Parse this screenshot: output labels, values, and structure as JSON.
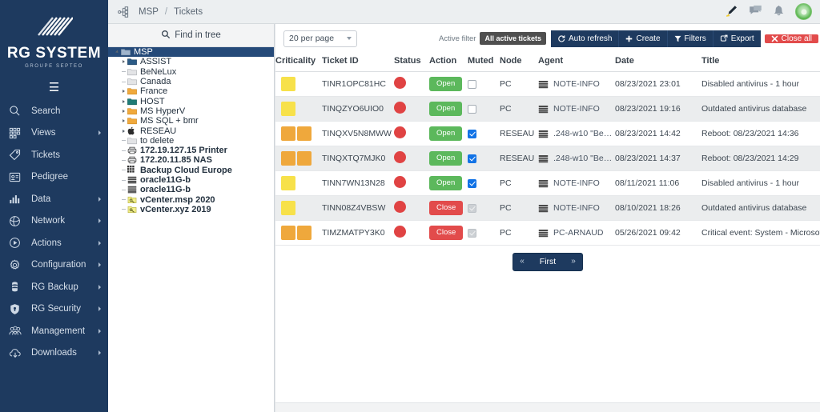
{
  "brand": {
    "name": "RG SYSTEM",
    "tagline": "GROUPE SEPTEO",
    "logo_icon": "rg-diagonal-stripes-logo",
    "menu_icon": "hamburger-menu-icon",
    "accent_navy": "#1e3a5f"
  },
  "sidebar": {
    "items": [
      {
        "label": "Search",
        "icon": "search-icon",
        "caret": false
      },
      {
        "label": "Views",
        "icon": "grid-views-icon",
        "caret": true
      },
      {
        "label": "Tickets",
        "icon": "tag-tickets-icon",
        "caret": false
      },
      {
        "label": "Pedigree",
        "icon": "id-card-icon",
        "caret": false
      },
      {
        "label": "Data",
        "icon": "bar-chart-icon",
        "caret": true
      },
      {
        "label": "Network",
        "icon": "network-globe-icon",
        "caret": true
      },
      {
        "label": "Actions",
        "icon": "play-circle-icon",
        "caret": true
      },
      {
        "label": "Configuration",
        "icon": "gear-icon",
        "caret": true
      },
      {
        "label": "RG Backup",
        "icon": "database-stack-icon",
        "caret": true
      },
      {
        "label": "RG Security",
        "icon": "shield-lock-icon",
        "caret": true
      },
      {
        "label": "Management",
        "icon": "users-group-icon",
        "caret": true
      },
      {
        "label": "Downloads",
        "icon": "download-cloud-icon",
        "caret": true
      }
    ]
  },
  "topbar": {
    "org_icon": "org-tree-icon",
    "breadcrumb": [
      "MSP",
      "Tickets"
    ],
    "separator": "/",
    "icons": [
      {
        "name": "pen-highlighter-icon"
      },
      {
        "name": "chat-bubble-icon"
      },
      {
        "name": "bell-notification-icon"
      },
      {
        "name": "user-avatar-icon"
      }
    ]
  },
  "tree": {
    "search_label": "Find in tree",
    "search_icon": "search-icon",
    "nodes": [
      {
        "label": "MSP",
        "icon": "folder-blue",
        "expander": "expanded",
        "selected": true,
        "bold": false,
        "indent": 0
      },
      {
        "label": "ASSIST",
        "icon": "folder-navy",
        "expander": "collapsed",
        "selected": false,
        "bold": false,
        "indent": 1
      },
      {
        "label": "BeNeLux",
        "icon": "folder-grey",
        "expander": "leaf",
        "selected": false,
        "bold": false,
        "indent": 1
      },
      {
        "label": "Canada",
        "icon": "folder-grey",
        "expander": "leaf",
        "selected": false,
        "bold": false,
        "indent": 1
      },
      {
        "label": "France",
        "icon": "folder-orange",
        "expander": "collapsed",
        "selected": false,
        "bold": false,
        "indent": 1
      },
      {
        "label": "HOST",
        "icon": "folder-teal",
        "expander": "collapsed",
        "selected": false,
        "bold": false,
        "indent": 1
      },
      {
        "label": "MS HyperV",
        "icon": "folder-orange",
        "expander": "collapsed",
        "selected": false,
        "bold": false,
        "indent": 1
      },
      {
        "label": "MS SQL + bmr",
        "icon": "folder-orange",
        "expander": "collapsed",
        "selected": false,
        "bold": false,
        "indent": 1
      },
      {
        "label": "RESEAU",
        "icon": "apple-icon",
        "expander": "collapsed",
        "selected": false,
        "bold": false,
        "indent": 1
      },
      {
        "label": "to delete",
        "icon": "folder-grey",
        "expander": "leaf",
        "selected": false,
        "bold": false,
        "indent": 1
      },
      {
        "label": "172.19.127.15 Printer",
        "icon": "printer-icon",
        "expander": "leaf",
        "selected": false,
        "bold": true,
        "indent": 1
      },
      {
        "label": "172.20.11.85 NAS",
        "icon": "printer-icon",
        "expander": "leaf",
        "selected": false,
        "bold": true,
        "indent": 1
      },
      {
        "label": "Backup Cloud Europe",
        "icon": "grid-cloud-icon",
        "expander": "leaf",
        "selected": false,
        "bold": true,
        "indent": 1
      },
      {
        "label": "oracle11G-b",
        "icon": "server-icon",
        "expander": "leaf",
        "selected": false,
        "bold": true,
        "indent": 1
      },
      {
        "label": "oracle11G-b",
        "icon": "server-icon",
        "expander": "leaf",
        "selected": false,
        "bold": true,
        "indent": 1
      },
      {
        "label": "vCenter.msp 2020",
        "icon": "vcenter-icon",
        "expander": "leaf",
        "selected": false,
        "bold": true,
        "indent": 1
      },
      {
        "label": "vCenter.xyz 2019",
        "icon": "vcenter-icon",
        "expander": "leaf",
        "selected": false,
        "bold": true,
        "indent": 1
      }
    ]
  },
  "toolbar": {
    "per_page": "20 per page",
    "active_filter_label": "Active filter",
    "active_filter_value": "All active tickets",
    "buttons": [
      {
        "label": "Auto refresh",
        "icon": "refresh-icon",
        "style": "navy"
      },
      {
        "label": "Create",
        "icon": "plus-icon",
        "style": "navy"
      },
      {
        "label": "Filters",
        "icon": "funnel-icon",
        "style": "navy"
      },
      {
        "label": "Export",
        "icon": "export-icon",
        "style": "navy"
      },
      {
        "label": "Close all",
        "icon": "x-icon",
        "style": "danger"
      }
    ]
  },
  "table": {
    "columns": [
      "Criticality",
      "Ticket ID",
      "Status",
      "Action",
      "Muted",
      "Node",
      "Agent",
      "Date",
      "Title"
    ],
    "rows": [
      {
        "criticality": 1,
        "ticket_id": "TINR1OPC81HC",
        "status": "critical",
        "action": "Open",
        "muted": "unchecked",
        "node": "PC",
        "agent": "NOTE-INFO",
        "date": "08/23/2021 23:01",
        "title": "Disabled antivirus - 1 hour"
      },
      {
        "criticality": 1,
        "ticket_id": "TINQZYO6UIO0",
        "status": "critical",
        "action": "Open",
        "muted": "unchecked",
        "node": "PC",
        "agent": "NOTE-INFO",
        "date": "08/23/2021 19:16",
        "title": "Outdated antivirus database"
      },
      {
        "criticality": 2,
        "ticket_id": "TINQXV5N8MWW",
        "status": "critical",
        "action": "Open",
        "muted": "checked",
        "node": "RESEAU",
        "agent": ".248-w10 \"Ben…",
        "date": "08/23/2021 14:42",
        "title": "Reboot: 08/23/2021 14:36"
      },
      {
        "criticality": 2,
        "ticket_id": "TINQXTQ7MJK0",
        "status": "critical",
        "action": "Open",
        "muted": "checked",
        "node": "RESEAU",
        "agent": ".248-w10 \"Ben…",
        "date": "08/23/2021 14:37",
        "title": "Reboot: 08/23/2021 14:29"
      },
      {
        "criticality": 1,
        "ticket_id": "TINN7WN13N28",
        "status": "critical",
        "action": "Open",
        "muted": "checked",
        "node": "PC",
        "agent": "NOTE-INFO",
        "date": "08/11/2021 11:06",
        "title": "Disabled antivirus - 1 hour"
      },
      {
        "criticality": 1,
        "ticket_id": "TINN08Z4VBSW",
        "status": "critical",
        "action": "Close",
        "muted": "disabled",
        "node": "PC",
        "agent": "NOTE-INFO",
        "date": "08/10/2021 18:26",
        "title": "Outdated antivirus database"
      },
      {
        "criticality": 2,
        "ticket_id": "TIMZMATPY3K0",
        "status": "critical",
        "action": "Close",
        "muted": "disabled",
        "node": "PC",
        "agent": "PC-ARNAUD",
        "date": "05/26/2021 09:42",
        "title": "Critical event: System - Microsoft-Window"
      }
    ],
    "criticality_colors": {
      "1": "#f7e14a",
      "2": "#efa83c"
    },
    "status_color": "#e04343"
  },
  "pager": {
    "prev": "«",
    "label": "First",
    "next": "»"
  }
}
